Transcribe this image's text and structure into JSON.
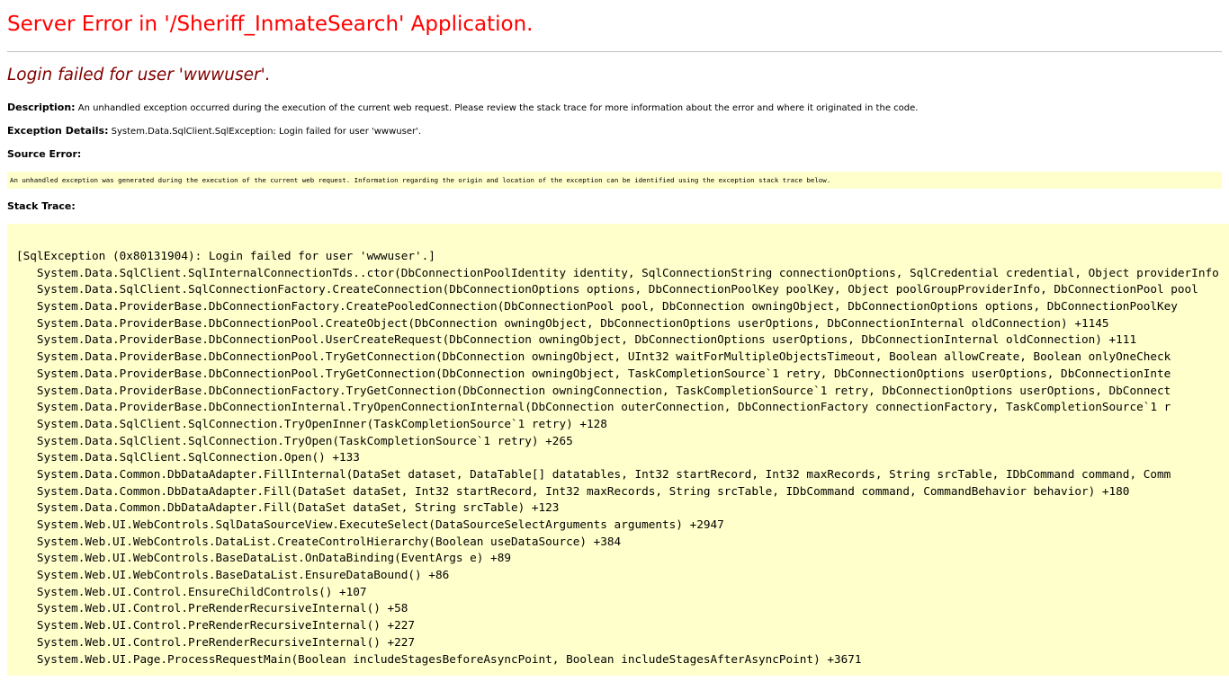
{
  "error_page": {
    "title": "Server Error in '/Sheriff_InmateSearch' Application.",
    "subtitle": "Login failed for user 'wwwuser'.",
    "description_label": "Description:",
    "description_text": " An unhandled exception occurred during the execution of the current web request. Please review the stack trace for more information about the error and where it originated in the code.",
    "exception_label": "Exception Details:",
    "exception_text": " System.Data.SqlClient.SqlException: Login failed for user 'wwwuser'.",
    "source_error_label": "Source Error:",
    "source_error_text": "An unhandled exception was generated during the execution of the current web request. Information regarding the origin and location of the exception can be identified using the exception stack trace below.",
    "stack_trace_label": "Stack Trace:",
    "stack_trace_lines": [
      "[SqlException (0x80131904): Login failed for user 'wwwuser'.]",
      "   System.Data.SqlClient.SqlInternalConnectionTds..ctor(DbConnectionPoolIdentity identity, SqlConnectionString connectionOptions, SqlCredential credential, Object providerInfo",
      "   System.Data.SqlClient.SqlConnectionFactory.CreateConnection(DbConnectionOptions options, DbConnectionPoolKey poolKey, Object poolGroupProviderInfo, DbConnectionPool pool",
      "   System.Data.ProviderBase.DbConnectionFactory.CreatePooledConnection(DbConnectionPool pool, DbConnection owningObject, DbConnectionOptions options, DbConnectionPoolKey",
      "   System.Data.ProviderBase.DbConnectionPool.CreateObject(DbConnection owningObject, DbConnectionOptions userOptions, DbConnectionInternal oldConnection) +1145",
      "   System.Data.ProviderBase.DbConnectionPool.UserCreateRequest(DbConnection owningObject, DbConnectionOptions userOptions, DbConnectionInternal oldConnection) +111",
      "   System.Data.ProviderBase.DbConnectionPool.TryGetConnection(DbConnection owningObject, UInt32 waitForMultipleObjectsTimeout, Boolean allowCreate, Boolean onlyOneCheck",
      "   System.Data.ProviderBase.DbConnectionPool.TryGetConnection(DbConnection owningObject, TaskCompletionSource`1 retry, DbConnectionOptions userOptions, DbConnectionInte",
      "   System.Data.ProviderBase.DbConnectionFactory.TryGetConnection(DbConnection owningConnection, TaskCompletionSource`1 retry, DbConnectionOptions userOptions, DbConnect",
      "   System.Data.ProviderBase.DbConnectionInternal.TryOpenConnectionInternal(DbConnection outerConnection, DbConnectionFactory connectionFactory, TaskCompletionSource`1 r",
      "   System.Data.SqlClient.SqlConnection.TryOpenInner(TaskCompletionSource`1 retry) +128",
      "   System.Data.SqlClient.SqlConnection.TryOpen(TaskCompletionSource`1 retry) +265",
      "   System.Data.SqlClient.SqlConnection.Open() +133",
      "   System.Data.Common.DbDataAdapter.FillInternal(DataSet dataset, DataTable[] datatables, Int32 startRecord, Int32 maxRecords, String srcTable, IDbCommand command, Comm",
      "   System.Data.Common.DbDataAdapter.Fill(DataSet dataSet, Int32 startRecord, Int32 maxRecords, String srcTable, IDbCommand command, CommandBehavior behavior) +180",
      "   System.Data.Common.DbDataAdapter.Fill(DataSet dataSet, String srcTable) +123",
      "   System.Web.UI.WebControls.SqlDataSourceView.ExecuteSelect(DataSourceSelectArguments arguments) +2947",
      "   System.Web.UI.WebControls.DataList.CreateControlHierarchy(Boolean useDataSource) +384",
      "   System.Web.UI.WebControls.BaseDataList.OnDataBinding(EventArgs e) +89",
      "   System.Web.UI.WebControls.BaseDataList.EnsureDataBound() +86",
      "   System.Web.UI.Control.EnsureChildControls() +107",
      "   System.Web.UI.Control.PreRenderRecursiveInternal() +58",
      "   System.Web.UI.Control.PreRenderRecursiveInternal() +227",
      "   System.Web.UI.Control.PreRenderRecursiveInternal() +227",
      "   System.Web.UI.Page.ProcessRequestMain(Boolean includeStagesBeforeAsyncPoint, Boolean includeStagesAfterAsyncPoint) +3671"
    ]
  },
  "colors": {
    "title": "#ff0000",
    "subtitle": "#800000",
    "code_background": "#ffffcc",
    "rule": "#c0c0c0"
  }
}
